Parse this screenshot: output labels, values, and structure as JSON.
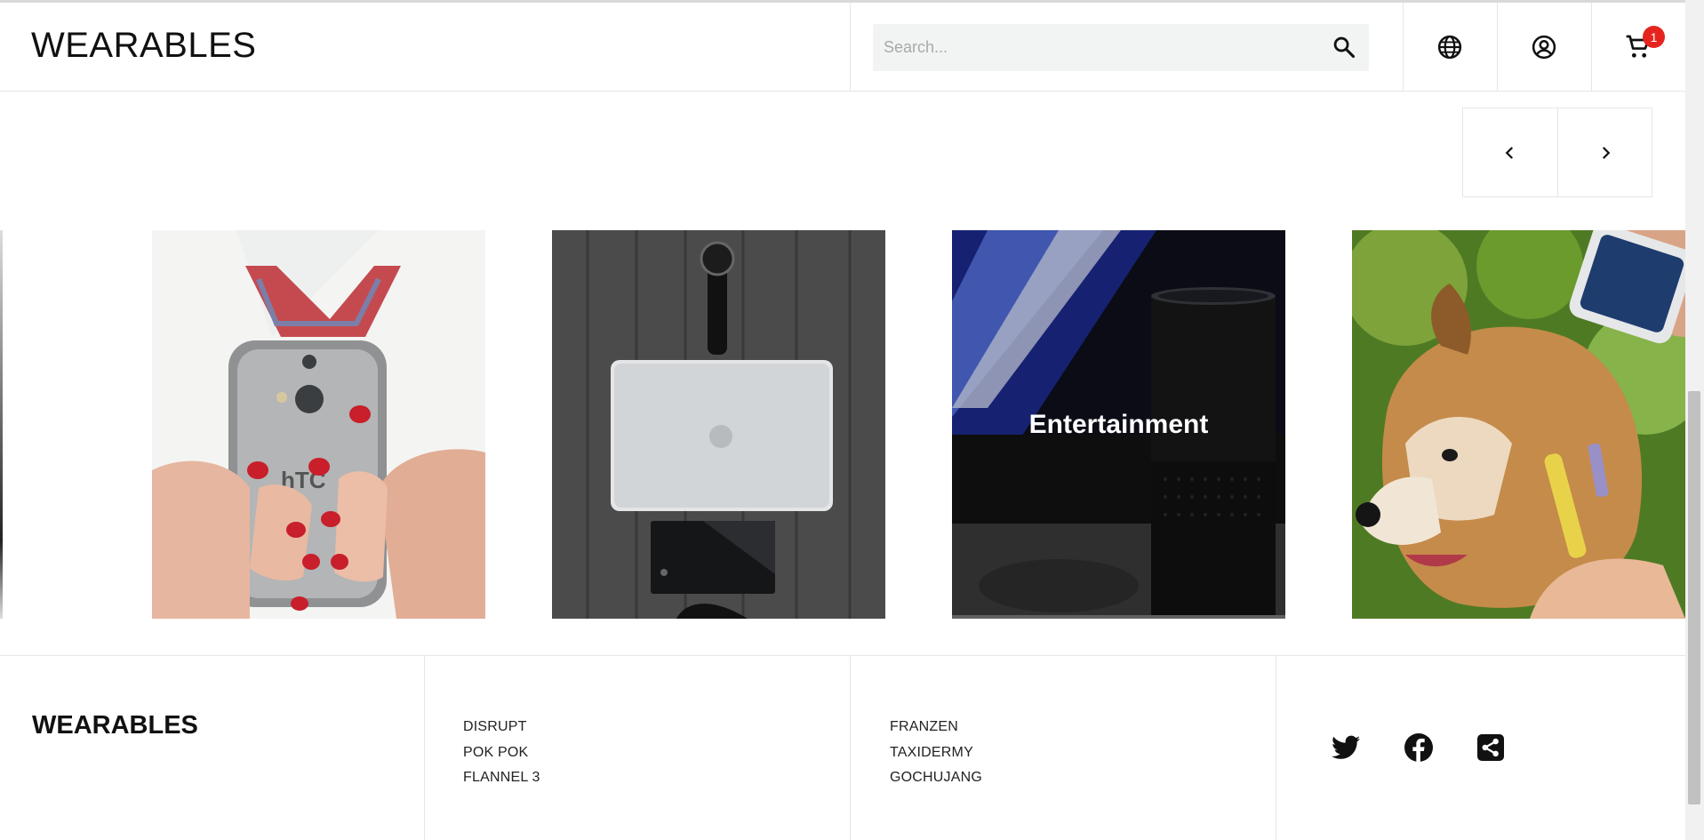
{
  "header": {
    "brand": "WEARABLES",
    "search": {
      "placeholder": "Search...",
      "value": ""
    },
    "cart_count": "1",
    "icons": [
      "search-icon",
      "globe-icon",
      "account-icon",
      "cart-icon"
    ]
  },
  "carousel": {
    "controls": [
      "chevron-left-icon",
      "chevron-right-icon"
    ],
    "tiles": [
      {
        "image": "woman holding smartphone",
        "label": ""
      },
      {
        "image": "laptop, watch and phone on wooden table",
        "label": ""
      },
      {
        "image": "smart speaker in front of screen",
        "label": "Entertainment"
      },
      {
        "image": "puppy with smart collar",
        "label": ""
      }
    ]
  },
  "footer": {
    "brand": "WEARABLES",
    "links_col1": [
      "DISRUPT",
      "POK POK",
      "FLANNEL 3"
    ],
    "links_col2": [
      "FRANZEN",
      "TAXIDERMY",
      "GOCHUJANG"
    ],
    "social": [
      "twitter-icon",
      "facebook-icon",
      "share-icon"
    ]
  },
  "colors": {
    "badge": "#e52420",
    "search_bg": "#f2f3f3",
    "divider": "#e6e6e6"
  }
}
